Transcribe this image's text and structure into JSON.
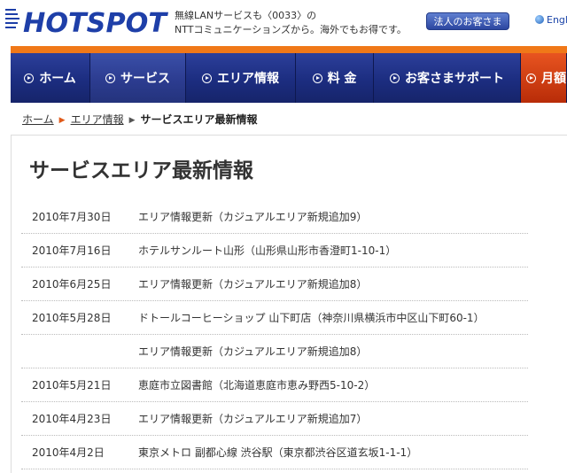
{
  "header": {
    "logo_text": "HOTSPOT",
    "tagline_line1": "無線LANサービスも〈0033〉の",
    "tagline_line2": "NTTコミュニケーションズから。海外でもお得です。",
    "corp_button": "法人のお客さま",
    "lang_link": "English"
  },
  "nav": {
    "items": [
      {
        "label": "ホーム"
      },
      {
        "label": "サービス"
      },
      {
        "label": "エリア情報"
      },
      {
        "label": "料 金"
      },
      {
        "label": "お客さまサポート"
      },
      {
        "label": "月額"
      }
    ]
  },
  "breadcrumb": {
    "home": "ホーム",
    "area": "エリア情報",
    "current": "サービスエリア最新情報"
  },
  "page": {
    "title": "サービスエリア最新情報"
  },
  "news": [
    {
      "date": "2010年7月30日",
      "text": "エリア情報更新（カジュアルエリア新規追加9）"
    },
    {
      "date": "2010年7月16日",
      "text": "ホテルサンルート山形（山形県山形市香澄町1-10-1）"
    },
    {
      "date": "2010年6月25日",
      "text": "エリア情報更新（カジュアルエリア新規追加8）"
    },
    {
      "date": "2010年5月28日",
      "text": "ドトールコーヒーショップ 山下町店（神奈川県横浜市中区山下町60-1）"
    },
    {
      "date": "",
      "text": "エリア情報更新（カジュアルエリア新規追加8）"
    },
    {
      "date": "2010年5月21日",
      "text": "恵庭市立図書館（北海道恵庭市恵み野西5-10-2）"
    },
    {
      "date": "2010年4月23日",
      "text": "エリア情報更新（カジュアルエリア新規追加7）"
    },
    {
      "date": "2010年4月2日",
      "text": "東京メトロ 副都心線 渋谷駅（東京都渋谷区道玄坂1-1-1）"
    }
  ]
}
